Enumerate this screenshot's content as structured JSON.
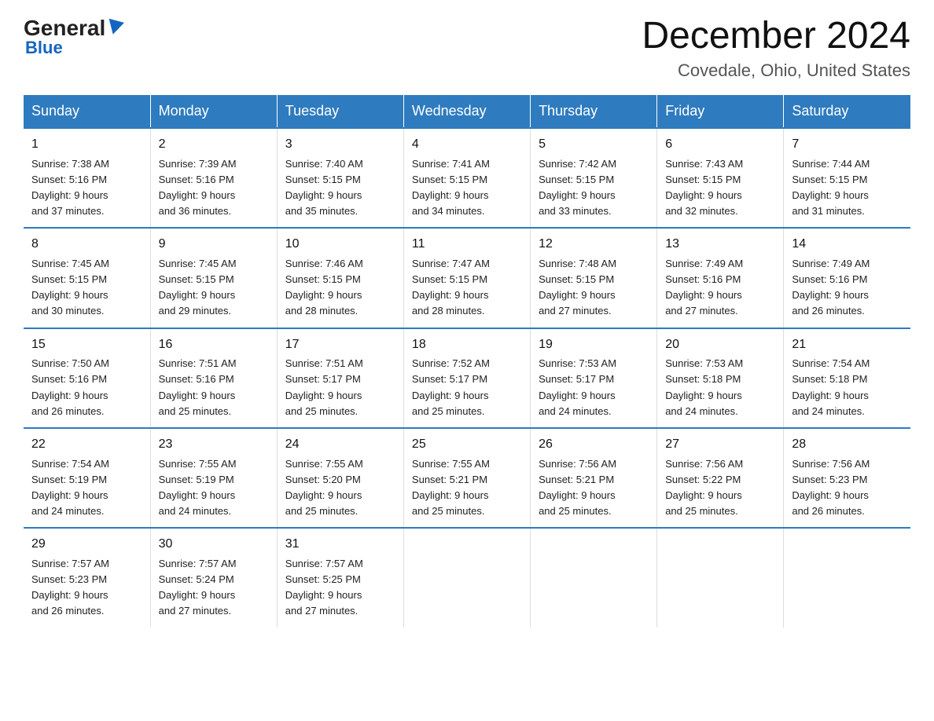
{
  "logo": {
    "general": "General",
    "blue": "Blue"
  },
  "title": "December 2024",
  "subtitle": "Covedale, Ohio, United States",
  "days_of_week": [
    "Sunday",
    "Monday",
    "Tuesday",
    "Wednesday",
    "Thursday",
    "Friday",
    "Saturday"
  ],
  "weeks": [
    [
      {
        "day": "1",
        "info": "Sunrise: 7:38 AM\nSunset: 5:16 PM\nDaylight: 9 hours\nand 37 minutes."
      },
      {
        "day": "2",
        "info": "Sunrise: 7:39 AM\nSunset: 5:16 PM\nDaylight: 9 hours\nand 36 minutes."
      },
      {
        "day": "3",
        "info": "Sunrise: 7:40 AM\nSunset: 5:15 PM\nDaylight: 9 hours\nand 35 minutes."
      },
      {
        "day": "4",
        "info": "Sunrise: 7:41 AM\nSunset: 5:15 PM\nDaylight: 9 hours\nand 34 minutes."
      },
      {
        "day": "5",
        "info": "Sunrise: 7:42 AM\nSunset: 5:15 PM\nDaylight: 9 hours\nand 33 minutes."
      },
      {
        "day": "6",
        "info": "Sunrise: 7:43 AM\nSunset: 5:15 PM\nDaylight: 9 hours\nand 32 minutes."
      },
      {
        "day": "7",
        "info": "Sunrise: 7:44 AM\nSunset: 5:15 PM\nDaylight: 9 hours\nand 31 minutes."
      }
    ],
    [
      {
        "day": "8",
        "info": "Sunrise: 7:45 AM\nSunset: 5:15 PM\nDaylight: 9 hours\nand 30 minutes."
      },
      {
        "day": "9",
        "info": "Sunrise: 7:45 AM\nSunset: 5:15 PM\nDaylight: 9 hours\nand 29 minutes."
      },
      {
        "day": "10",
        "info": "Sunrise: 7:46 AM\nSunset: 5:15 PM\nDaylight: 9 hours\nand 28 minutes."
      },
      {
        "day": "11",
        "info": "Sunrise: 7:47 AM\nSunset: 5:15 PM\nDaylight: 9 hours\nand 28 minutes."
      },
      {
        "day": "12",
        "info": "Sunrise: 7:48 AM\nSunset: 5:15 PM\nDaylight: 9 hours\nand 27 minutes."
      },
      {
        "day": "13",
        "info": "Sunrise: 7:49 AM\nSunset: 5:16 PM\nDaylight: 9 hours\nand 27 minutes."
      },
      {
        "day": "14",
        "info": "Sunrise: 7:49 AM\nSunset: 5:16 PM\nDaylight: 9 hours\nand 26 minutes."
      }
    ],
    [
      {
        "day": "15",
        "info": "Sunrise: 7:50 AM\nSunset: 5:16 PM\nDaylight: 9 hours\nand 26 minutes."
      },
      {
        "day": "16",
        "info": "Sunrise: 7:51 AM\nSunset: 5:16 PM\nDaylight: 9 hours\nand 25 minutes."
      },
      {
        "day": "17",
        "info": "Sunrise: 7:51 AM\nSunset: 5:17 PM\nDaylight: 9 hours\nand 25 minutes."
      },
      {
        "day": "18",
        "info": "Sunrise: 7:52 AM\nSunset: 5:17 PM\nDaylight: 9 hours\nand 25 minutes."
      },
      {
        "day": "19",
        "info": "Sunrise: 7:53 AM\nSunset: 5:17 PM\nDaylight: 9 hours\nand 24 minutes."
      },
      {
        "day": "20",
        "info": "Sunrise: 7:53 AM\nSunset: 5:18 PM\nDaylight: 9 hours\nand 24 minutes."
      },
      {
        "day": "21",
        "info": "Sunrise: 7:54 AM\nSunset: 5:18 PM\nDaylight: 9 hours\nand 24 minutes."
      }
    ],
    [
      {
        "day": "22",
        "info": "Sunrise: 7:54 AM\nSunset: 5:19 PM\nDaylight: 9 hours\nand 24 minutes."
      },
      {
        "day": "23",
        "info": "Sunrise: 7:55 AM\nSunset: 5:19 PM\nDaylight: 9 hours\nand 24 minutes."
      },
      {
        "day": "24",
        "info": "Sunrise: 7:55 AM\nSunset: 5:20 PM\nDaylight: 9 hours\nand 25 minutes."
      },
      {
        "day": "25",
        "info": "Sunrise: 7:55 AM\nSunset: 5:21 PM\nDaylight: 9 hours\nand 25 minutes."
      },
      {
        "day": "26",
        "info": "Sunrise: 7:56 AM\nSunset: 5:21 PM\nDaylight: 9 hours\nand 25 minutes."
      },
      {
        "day": "27",
        "info": "Sunrise: 7:56 AM\nSunset: 5:22 PM\nDaylight: 9 hours\nand 25 minutes."
      },
      {
        "day": "28",
        "info": "Sunrise: 7:56 AM\nSunset: 5:23 PM\nDaylight: 9 hours\nand 26 minutes."
      }
    ],
    [
      {
        "day": "29",
        "info": "Sunrise: 7:57 AM\nSunset: 5:23 PM\nDaylight: 9 hours\nand 26 minutes."
      },
      {
        "day": "30",
        "info": "Sunrise: 7:57 AM\nSunset: 5:24 PM\nDaylight: 9 hours\nand 27 minutes."
      },
      {
        "day": "31",
        "info": "Sunrise: 7:57 AM\nSunset: 5:25 PM\nDaylight: 9 hours\nand 27 minutes."
      },
      {
        "day": "",
        "info": ""
      },
      {
        "day": "",
        "info": ""
      },
      {
        "day": "",
        "info": ""
      },
      {
        "day": "",
        "info": ""
      }
    ]
  ]
}
